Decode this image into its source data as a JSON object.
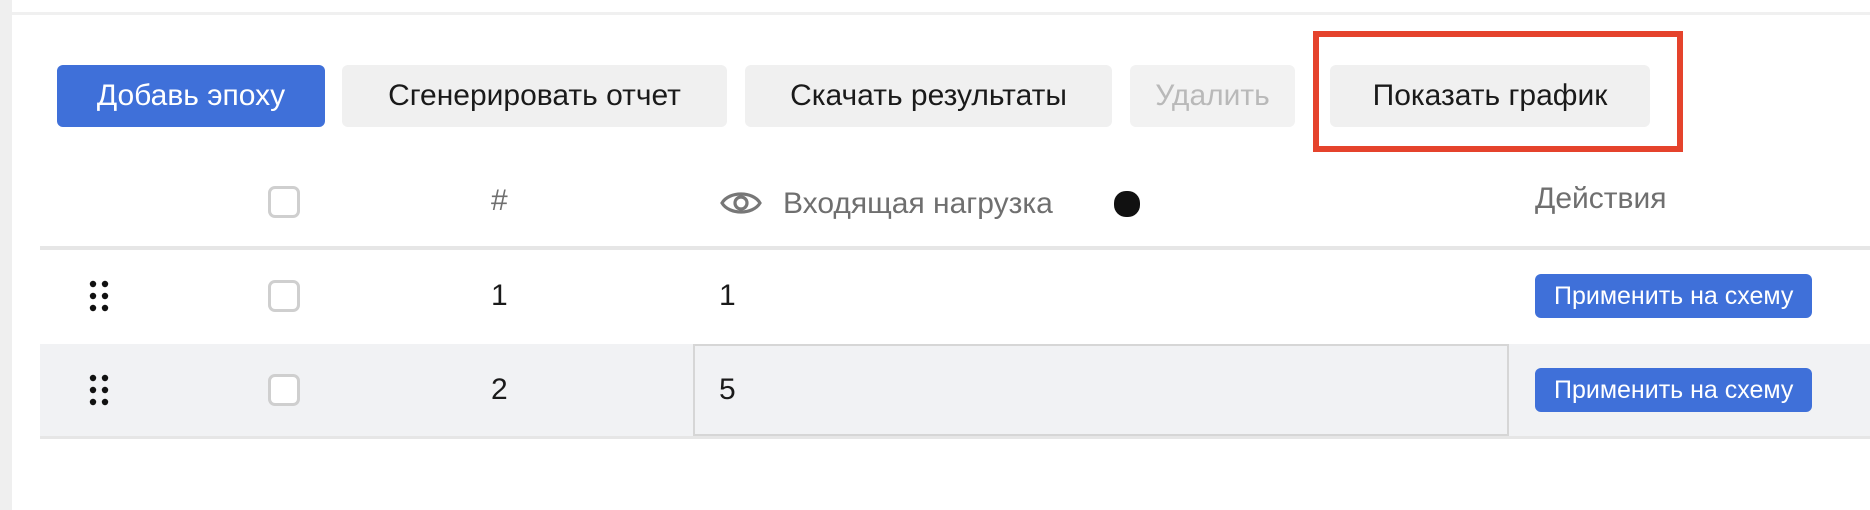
{
  "toolbar": {
    "add_epoch": "Добавь эпоху",
    "generate_report": "Сгенерировать отчет",
    "download_results": "Скачать результаты",
    "delete": "Удалить",
    "show_chart": "Показать график"
  },
  "table": {
    "columns": {
      "number": "#",
      "incoming_load": "Входящая нагрузка",
      "actions": "Действия"
    },
    "rows": [
      {
        "number": "1",
        "load": "1",
        "action": "Применить на схему"
      },
      {
        "number": "2",
        "load": "5",
        "action": "Применить на схему"
      }
    ]
  },
  "colors": {
    "primary": "#3f70d9",
    "highlight": "#e5432c",
    "selected_row": "#f1f2f4"
  },
  "icons": {
    "visibility": "eye-icon",
    "drag": "drag-handle-icon",
    "color_swatch": "color-dot"
  }
}
